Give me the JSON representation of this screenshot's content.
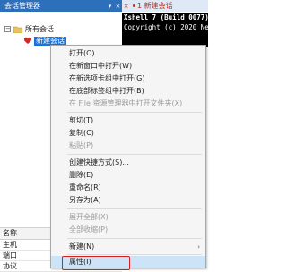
{
  "session_panel": {
    "title": "会话管理器",
    "pin_icon": "pin-icon",
    "close_icon": "close-icon",
    "tree": {
      "root_label": "所有会话",
      "root_expander": "−",
      "child_label": "新建会话"
    },
    "properties": {
      "header": "名称",
      "rows": [
        "主机",
        "端口",
        "协议"
      ]
    }
  },
  "terminal_tab": {
    "label": "1 新建会话",
    "close_glyph": "×"
  },
  "terminal": {
    "lines": [
      "Xshell 7 (Build 0077)",
      "Copyright (c) 2020 Net"
    ]
  },
  "context_menu": {
    "items": [
      {
        "label": "打开(O)",
        "disabled": false
      },
      {
        "label": "在新窗口中打开(W)",
        "disabled": false
      },
      {
        "label": "在新选项卡组中打开(G)",
        "disabled": false
      },
      {
        "label": "在底部标签组中打开(B)",
        "disabled": false
      },
      {
        "label": "在 File 资源管理器中打开文件夹(X)",
        "disabled": true
      },
      {
        "label": "剪切(T)",
        "disabled": false
      },
      {
        "label": "复制(C)",
        "disabled": false
      },
      {
        "label": "粘贴(P)",
        "disabled": true
      },
      {
        "label": "创建快捷方式(S)...",
        "disabled": false
      },
      {
        "label": "删除(E)",
        "disabled": false
      },
      {
        "label": "重命名(R)",
        "disabled": false
      },
      {
        "label": "另存为(A)",
        "disabled": false
      },
      {
        "label": "展开全部(X)",
        "disabled": true
      },
      {
        "label": "全部收缩(P)",
        "disabled": true
      },
      {
        "label": "新建(N)",
        "disabled": false
      },
      {
        "label": "属性(I)",
        "disabled": false
      }
    ]
  },
  "colors": {
    "header_blue": "#2e6fb9",
    "selection_blue": "#1a73d9",
    "highlight_outline": "#d62020",
    "terminal_bg": "#000000"
  }
}
